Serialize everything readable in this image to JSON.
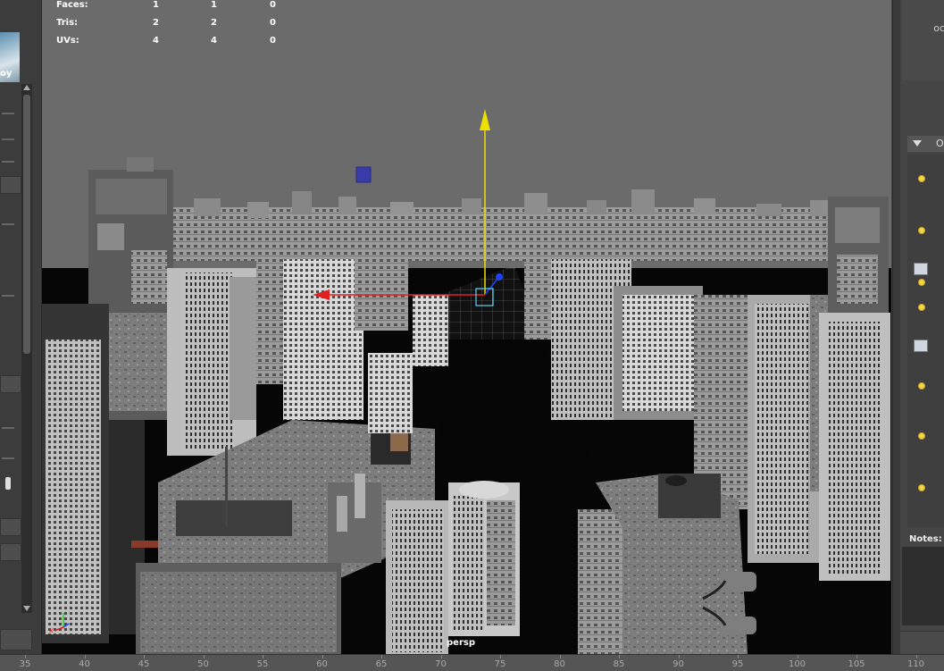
{
  "hud": {
    "rows": [
      {
        "label": "Faces:",
        "v1": "1",
        "v2": "1",
        "v3": "0"
      },
      {
        "label": "Tris:",
        "v1": "2",
        "v2": "2",
        "v3": "0"
      },
      {
        "label": "UVs:",
        "v1": "4",
        "v2": "4",
        "v3": "0"
      }
    ]
  },
  "viewport": {
    "camera_label": "persp"
  },
  "left_panel": {
    "thumbnail_text": "oy"
  },
  "right_panel": {
    "top_text": "oc",
    "section_header": "O",
    "notes_label": "Notes:"
  },
  "time_slider": {
    "ticks": [
      "35",
      "40",
      "45",
      "50",
      "55",
      "60",
      "65",
      "70",
      "75",
      "80",
      "85",
      "90",
      "95",
      "100",
      "105",
      "110"
    ]
  },
  "colors": {
    "viewport_bg": "#6b6b6b",
    "ground": "#060606",
    "axis_x": "#e02020",
    "axis_y": "#f0e000",
    "axis_z": "#2040ff",
    "attr_dot": "#f4d54a"
  },
  "icons": [
    "scroll-up-arrow-icon",
    "scroll-down-arrow-icon",
    "collapse-triangle-icon",
    "axis-gizmo-icon",
    "keyable-dot-icon",
    "connection-icon",
    "texture-icon"
  ]
}
